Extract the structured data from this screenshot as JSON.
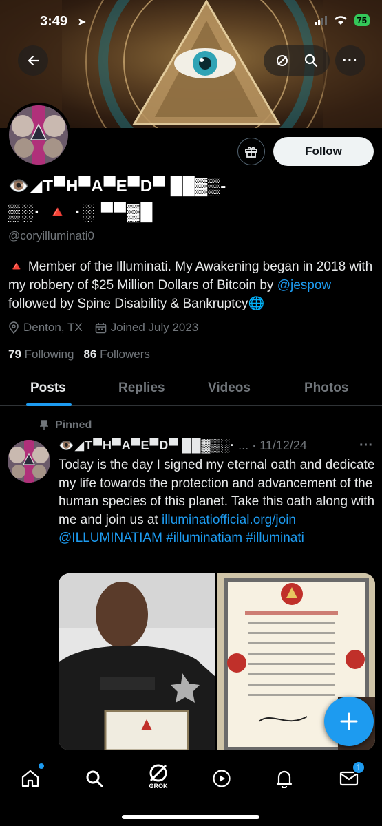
{
  "status_bar": {
    "time": "3:49",
    "battery": "75"
  },
  "profile": {
    "display_name_line1": "👁️◢T▀H▀A▀E▀D▀ ██▓▒-",
    "display_name_line2": "▒░· 🔺 ·░ ▀▀▓█",
    "handle": "@coryilluminati0",
    "bio_before_link": "🔺 Member of the Illuminati. My Awakening began in 2018 with my robbery of $25 Million Dollars of Bitcoin by ",
    "bio_link": "@jespow",
    "bio_after_link": " followed by Spine Disability & Bankruptcy🌐",
    "location": "Denton, TX",
    "joined": "Joined July 2023",
    "following_count": "79",
    "following_label": "Following",
    "followers_count": "86",
    "followers_label": "Followers",
    "follow_button": "Follow"
  },
  "tabs": [
    {
      "label": "Posts",
      "active": true
    },
    {
      "label": "Replies",
      "active": false
    },
    {
      "label": "Videos",
      "active": false
    },
    {
      "label": "Photos",
      "active": false
    }
  ],
  "post": {
    "pinned_label": "Pinned",
    "author": "👁️◢T▀H▀A▀E▀D▀ ██▓▒░·",
    "separator": " ... · ",
    "date": "11/12/24",
    "text": "Today is the day I signed my eternal oath and dedicate my life towards the protection and advancement of the human species of this planet. Take this oath along with me and join us at ",
    "link": "illuminatiofficial.org/join",
    "mention": "@ILLUMINATIAM",
    "hashtag1": "#illuminatiam",
    "hashtag2": "#illuminati"
  },
  "bottom_nav": {
    "grok_label": "GROK",
    "notification_badge": "1"
  },
  "colors": {
    "accent": "#1d9bf0",
    "background": "#000000",
    "muted": "#71767b"
  },
  "icons": [
    "back-arrow-icon",
    "ai-icon",
    "search-icon",
    "more-icon",
    "gift-icon",
    "location-icon",
    "calendar-icon",
    "pin-icon",
    "plus-icon",
    "home-icon",
    "grok-icon",
    "play-icon",
    "bell-icon",
    "mail-icon"
  ]
}
